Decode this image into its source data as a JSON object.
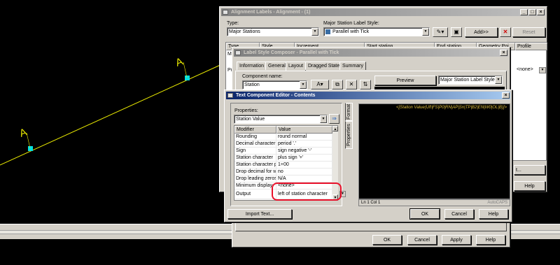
{
  "canvas": {
    "label_a": "A",
    "label_b": "A",
    "line_color": "#e8e800",
    "grip_color": "#00e0e0",
    "label_color": "#e8e800"
  },
  "alignment_window": {
    "title": "Alignment Labels - Alignment - (1)",
    "type_label": "Type:",
    "type_value": "Major Stations",
    "style_label": "Major Station Label Style:",
    "style_value": "Parallel with Tick",
    "add_button": "Add>>",
    "reset_button": "Reset",
    "columns": [
      "Type",
      "Style",
      "Increment",
      "Start station",
      "End station",
      "Geometry Poi...",
      "Profile"
    ],
    "row_partial_1": "M",
    "row_partial_2": "Pr",
    "profile_value": "<none>",
    "import_button": "t...",
    "help_button": "Help"
  },
  "composer_window": {
    "title": "Label Style Composer - Parallel with Tick",
    "tabs": [
      "Information",
      "General",
      "Layout",
      "Dragged State",
      "Summary"
    ],
    "component_name_label": "Component name:",
    "component_name_value": "Station",
    "preview_label": "Preview",
    "preview_value": "Major Station Label Style",
    "ok_button": "OK",
    "cancel_button": "Cancel",
    "apply_button": "Apply",
    "help_button": "Help"
  },
  "editor_window": {
    "title": "Text Component Editor - Contents",
    "properties_label": "Properties:",
    "properties_value": "Station Value",
    "grid_headers": [
      "Modifier",
      "Value"
    ],
    "grid_rows": [
      {
        "modifier": "Rounding",
        "value": "round normal"
      },
      {
        "modifier": "Decimal character",
        "value": "period '.'"
      },
      {
        "modifier": "Sign",
        "value": "sign negative '-'"
      },
      {
        "modifier": "Station character",
        "value": "plus sign '+'"
      },
      {
        "modifier": "Station character p",
        "value": "1+00"
      },
      {
        "modifier": "Drop decimal for wi",
        "value": "no"
      },
      {
        "modifier": "Drop leading zeros",
        "value": "N/A"
      },
      {
        "modifier": "Minimum display",
        "value": "<none>"
      },
      {
        "modifier": "Output",
        "value": "left of station character"
      }
    ],
    "side_tabs": [
      "Format",
      "Properties"
    ],
    "format_string": "<[Station Value(Uft|FS|P0|RN|AP|Sn|TP|B2|EN|W0|OL|B)]>",
    "status_left": "Ln 1 Col 1",
    "status_right": "AutoCAPS",
    "import_text_button": "Import Text...",
    "ok_button": "OK",
    "cancel_button": "Cancel",
    "help_button": "Help",
    "highlight_color": "#e8102a"
  }
}
